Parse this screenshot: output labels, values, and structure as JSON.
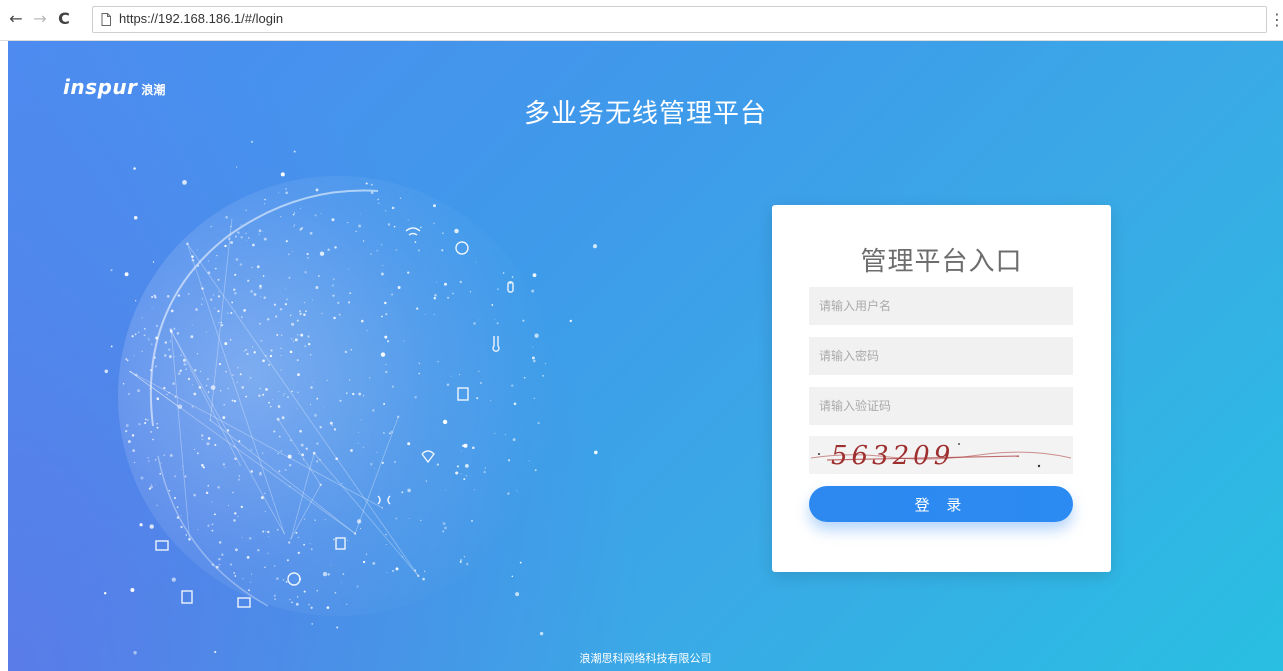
{
  "browser": {
    "url": "https://192.168.186.1/#/login",
    "back_glyph": "←",
    "forward_glyph": "→",
    "reload_glyph": "C",
    "menu_glyph": "⋮"
  },
  "page": {
    "logo_main": "inspur",
    "logo_sub": "浪潮",
    "title": "多业务无线管理平台",
    "footer": "浪潮思科网络科技有限公司"
  },
  "login": {
    "title": "管理平台入口",
    "username_placeholder": "请输入用户名",
    "password_placeholder": "请输入密码",
    "captcha_placeholder": "请输入验证码",
    "captcha_text": "563209",
    "button_label": "登 录"
  },
  "colors": {
    "button": "#2d88f0",
    "background_start": "#4d8bf0",
    "background_end": "#29bfe2"
  }
}
